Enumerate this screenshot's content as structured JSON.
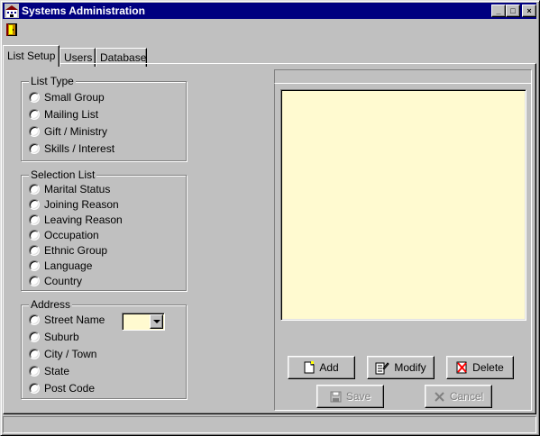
{
  "window": {
    "title": "Systems Administration",
    "controls": {
      "minimize": "_",
      "maximize": "□",
      "close": "×"
    }
  },
  "tabs": [
    {
      "label": "List Setup",
      "active": true
    },
    {
      "label": "Users",
      "active": false
    },
    {
      "label": "Database",
      "active": false
    }
  ],
  "list_type": {
    "label": "List Type",
    "options": [
      "Small Group",
      "Mailing List",
      "Gift / Ministry",
      "Skills / Interest"
    ]
  },
  "selection_list": {
    "label": "Selection List",
    "options": [
      "Marital Status",
      "Joining Reason",
      "Leaving Reason",
      "Occupation",
      "Ethnic Group",
      "Language",
      "Country"
    ]
  },
  "address": {
    "label": "Address",
    "options": [
      "Street Name",
      "Suburb",
      "City / Town",
      "State",
      "Post Code"
    ],
    "combo_value": ""
  },
  "buttons": {
    "add": "Add",
    "modify": "Modify",
    "delete": "Delete",
    "save": "Save",
    "cancel": "Cancel"
  },
  "colors": {
    "titlebar": "#000080",
    "list_background": "#fffad0",
    "face": "#c0c0c0"
  }
}
